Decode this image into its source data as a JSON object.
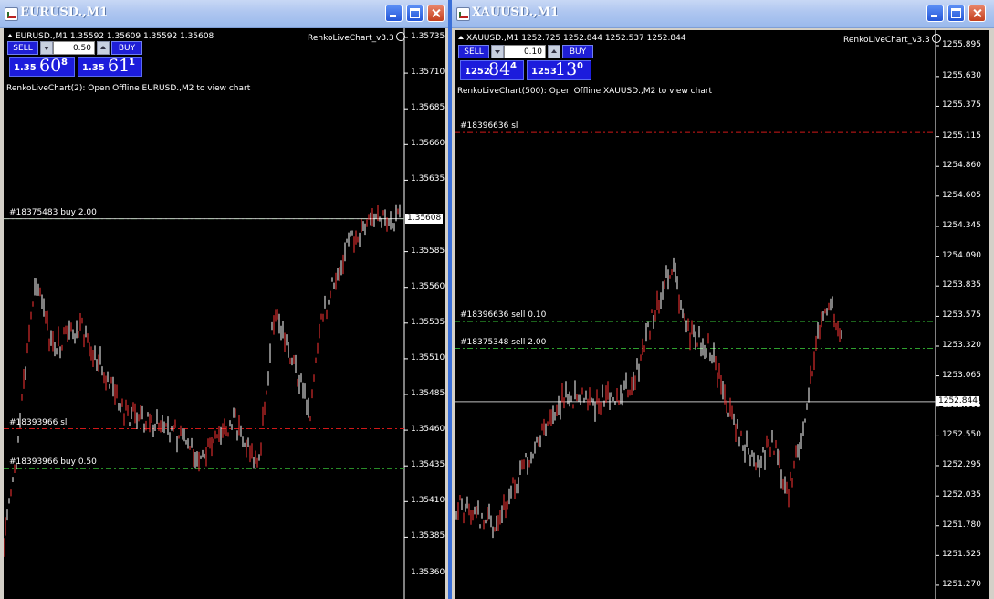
{
  "windows": [
    {
      "id": "eur",
      "title": "EURUSD.,M1",
      "symbol_line": "EURUSD.,M1  1.35592 1.35609 1.35592 1.35608",
      "ea_name": "RenkoLiveChart_v3.3",
      "info": "RenkoLiveChart(2): Open Offline EURUSD.,M2 to view chart",
      "trade_panel": {
        "sell_label": "SELL",
        "buy_label": "BUY",
        "lot": "0.50",
        "bid": {
          "small": "1.35",
          "big": "60",
          "sup": "8"
        },
        "ask": {
          "small": "1.35",
          "big": "61",
          "sup": "1"
        }
      },
      "orders": [
        {
          "label": "#18375483 buy 2.00",
          "price": 1.35608,
          "type": "buy"
        },
        {
          "label": "#18393966 sl",
          "price": 1.35461,
          "type": "sl"
        },
        {
          "label": "#18393966 buy 0.50",
          "price": 1.35433,
          "type": "buy"
        }
      ],
      "current_price": "1.35608",
      "axis_ticks": [
        "1.35735",
        "1.35710",
        "1.35685",
        "1.35660",
        "1.35635",
        "1.35585",
        "1.35560",
        "1.35535",
        "1.35510",
        "1.35485",
        "1.35460",
        "1.35435",
        "1.35410",
        "1.35385",
        "1.35360",
        "1.35335"
      ],
      "colors": {
        "candle": "#ff3333",
        "buy_line": "#2ea02e",
        "sl_line": "#d01818"
      }
    },
    {
      "id": "xau",
      "title": "XAUUSD.,M1",
      "symbol_line": "XAUUSD.,M1  1252.725 1252.844 1252.537 1252.844",
      "ea_name": "RenkoLiveChart_v3.3",
      "info": "RenkoLiveChart(500): Open Offline XAUUSD.,M2 to view chart",
      "trade_panel": {
        "sell_label": "SELL",
        "buy_label": "BUY",
        "lot": "0.10",
        "bid": {
          "small": "1252",
          "big": "84",
          "sup": "4"
        },
        "ask": {
          "small": "1253",
          "big": "13",
          "sup": "0"
        }
      },
      "orders": [
        {
          "label": "#18396636 sl",
          "price": 1255.15,
          "type": "sl"
        },
        {
          "label": "#18396636 sell 0.10",
          "price": 1253.53,
          "type": "sell"
        },
        {
          "label": "#18375348 sell 2.00",
          "price": 1253.3,
          "type": "sell"
        }
      ],
      "current_price": "1252.844",
      "axis_ticks": [
        "1255.895",
        "1255.630",
        "1255.375",
        "1255.115",
        "1254.860",
        "1254.605",
        "1254.345",
        "1254.090",
        "1253.835",
        "1253.575",
        "1253.320",
        "1253.065",
        "1252.805",
        "1252.550",
        "1252.295",
        "1252.035",
        "1251.780",
        "1251.525",
        "1251.270"
      ],
      "colors": {
        "candle": "#ff3333",
        "sell_line": "#2ea02e",
        "sl_line": "#d01818"
      }
    }
  ]
}
